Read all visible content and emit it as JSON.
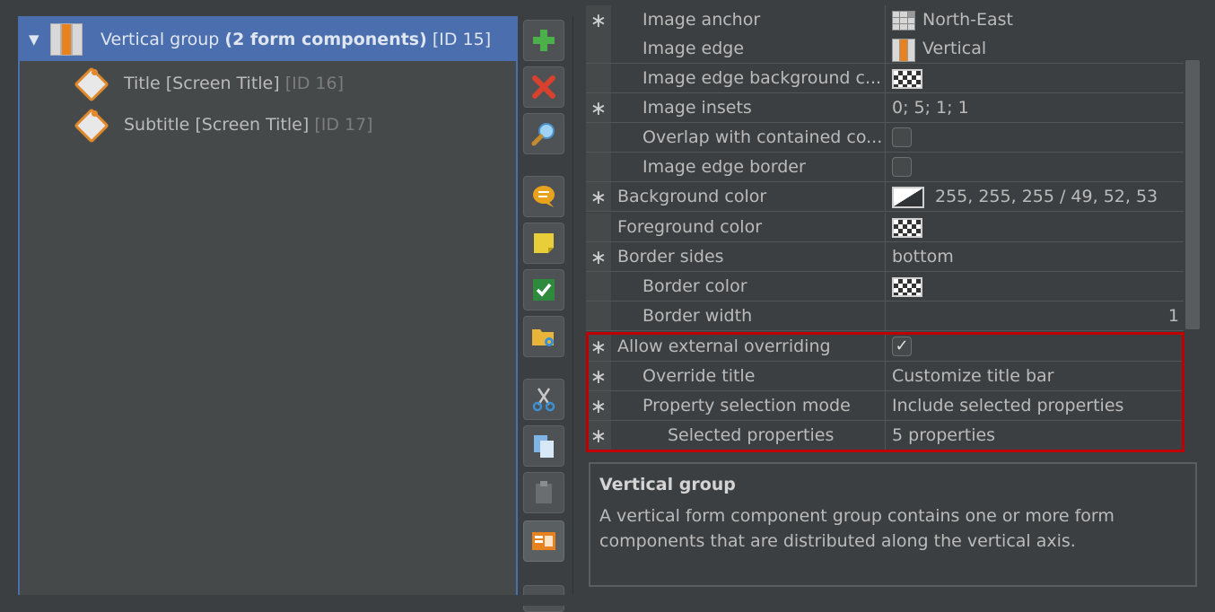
{
  "tree": {
    "group": {
      "name": "Vertical group",
      "detail": "(2 form components)",
      "id": "[ID 15]"
    },
    "children": [
      {
        "name": "Title [Screen Title]",
        "id": "[ID 16]"
      },
      {
        "name": "Subtitle [Screen Title]",
        "id": "[ID 17]"
      }
    ]
  },
  "toolbar": {
    "buttons": [
      "add-icon",
      "delete-icon",
      "search-icon",
      "comment-icon",
      "note-icon",
      "check-icon",
      "folder-settings-icon",
      "cut-icon",
      "copy-icon",
      "paste-icon",
      "form-icon"
    ]
  },
  "properties": {
    "rows": [
      {
        "star": "∗",
        "name": "Image anchor",
        "value": "North-East"
      },
      {
        "star": "",
        "name": "Image edge",
        "value": "Vertical"
      },
      {
        "star": "",
        "name": "Image edge background c...",
        "value": ""
      },
      {
        "star": "∗",
        "name": "Image insets",
        "value": "0; 5; 1; 1"
      },
      {
        "star": "",
        "name": "Overlap with contained co...",
        "value": ""
      },
      {
        "star": "",
        "name": "Image edge border",
        "value": ""
      },
      {
        "star": "∗",
        "name": "Background color",
        "value": "255, 255, 255 / 49, 52, 53"
      },
      {
        "star": "",
        "name": "Foreground color",
        "value": ""
      },
      {
        "star": "∗",
        "name": "Border sides",
        "value": "bottom"
      },
      {
        "star": "",
        "name": "Border color",
        "value": ""
      },
      {
        "star": "",
        "name": "Border width",
        "value": "1"
      },
      {
        "star": "∗",
        "name": "Allow external overriding",
        "value": "✓"
      },
      {
        "star": "∗",
        "name": "Override title",
        "value": "Customize title bar"
      },
      {
        "star": "∗",
        "name": "Property selection mode",
        "value": "Include selected properties"
      },
      {
        "star": "∗",
        "name": "Selected properties",
        "value": "5 properties"
      }
    ]
  },
  "description": {
    "title": "Vertical group",
    "body": "A vertical form component group contains one or more form\ncomponents that are distributed along the vertical axis."
  },
  "colors": {
    "background": "#3c3f41",
    "selection": "#4b6eaf",
    "highlight": "#c00000",
    "accent_orange": "#e8821e"
  }
}
